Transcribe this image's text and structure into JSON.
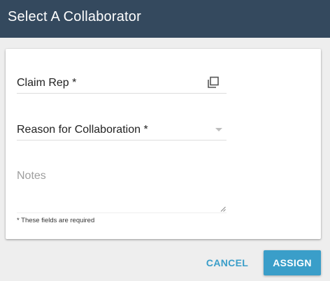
{
  "dialog": {
    "title": "Select A Collaborator",
    "header_color": "#34495e",
    "accent_color": "#3a9ec9"
  },
  "form": {
    "claim_rep": {
      "label": "Claim Rep *",
      "icon": "copy-icon"
    },
    "reason": {
      "label": "Reason for Collaboration *",
      "icon": "chevron-down-icon"
    },
    "notes": {
      "placeholder": "Notes",
      "value": ""
    },
    "required_note": "* These fields are required"
  },
  "actions": {
    "cancel_label": "CANCEL",
    "assign_label": "ASSIGN"
  }
}
